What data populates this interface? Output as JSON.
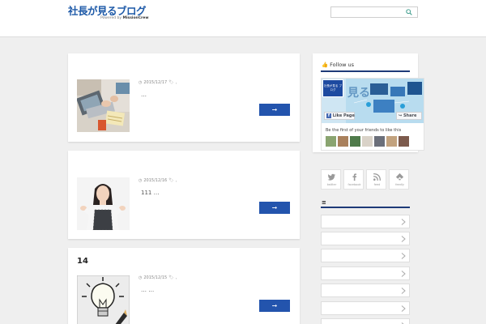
{
  "header": {
    "logo_text": "社長が見るブログ",
    "logo_sub_prefix": "Powered by",
    "logo_sub_brand": "MissionCrew",
    "search_placeholder": "",
    "search_icon": "search-icon"
  },
  "posts": [
    {
      "title": "",
      "date": "2015/12/17",
      "tags": ",",
      "excerpt": "…",
      "button": "➞",
      "thumb": "laptop-hands-photo"
    },
    {
      "title": "",
      "date": "2015/12/16",
      "tags": ",",
      "excerpt": "111 …",
      "button": "➞",
      "thumb": "woman-shrugging-photo"
    },
    {
      "title": "14",
      "date": "2015/12/15",
      "tags": ",",
      "excerpt": "… …",
      "button": "➞",
      "thumb": "lightbulb-sketch-photo"
    }
  ],
  "sidebar": {
    "follow_title": "Follow us",
    "facebook": {
      "page_name": "社長が見る ブログ",
      "like_label": "Like Page",
      "share_label": "Share",
      "friends_text": "Be the first of your friends to like this"
    },
    "social": [
      {
        "label": "twitter",
        "icon": "twitter-icon"
      },
      {
        "label": "facebook",
        "icon": "facebook-icon"
      },
      {
        "label": "feed",
        "icon": "rss-icon"
      },
      {
        "label": "feedly",
        "icon": "feedly-icon"
      }
    ],
    "menu_heading": "≡",
    "links": [
      "",
      "",
      "",
      "",
      "",
      "",
      ""
    ]
  },
  "colors": {
    "accent": "#2354ad",
    "rule": "#1e3a78",
    "logo": "#1e5aa8"
  }
}
